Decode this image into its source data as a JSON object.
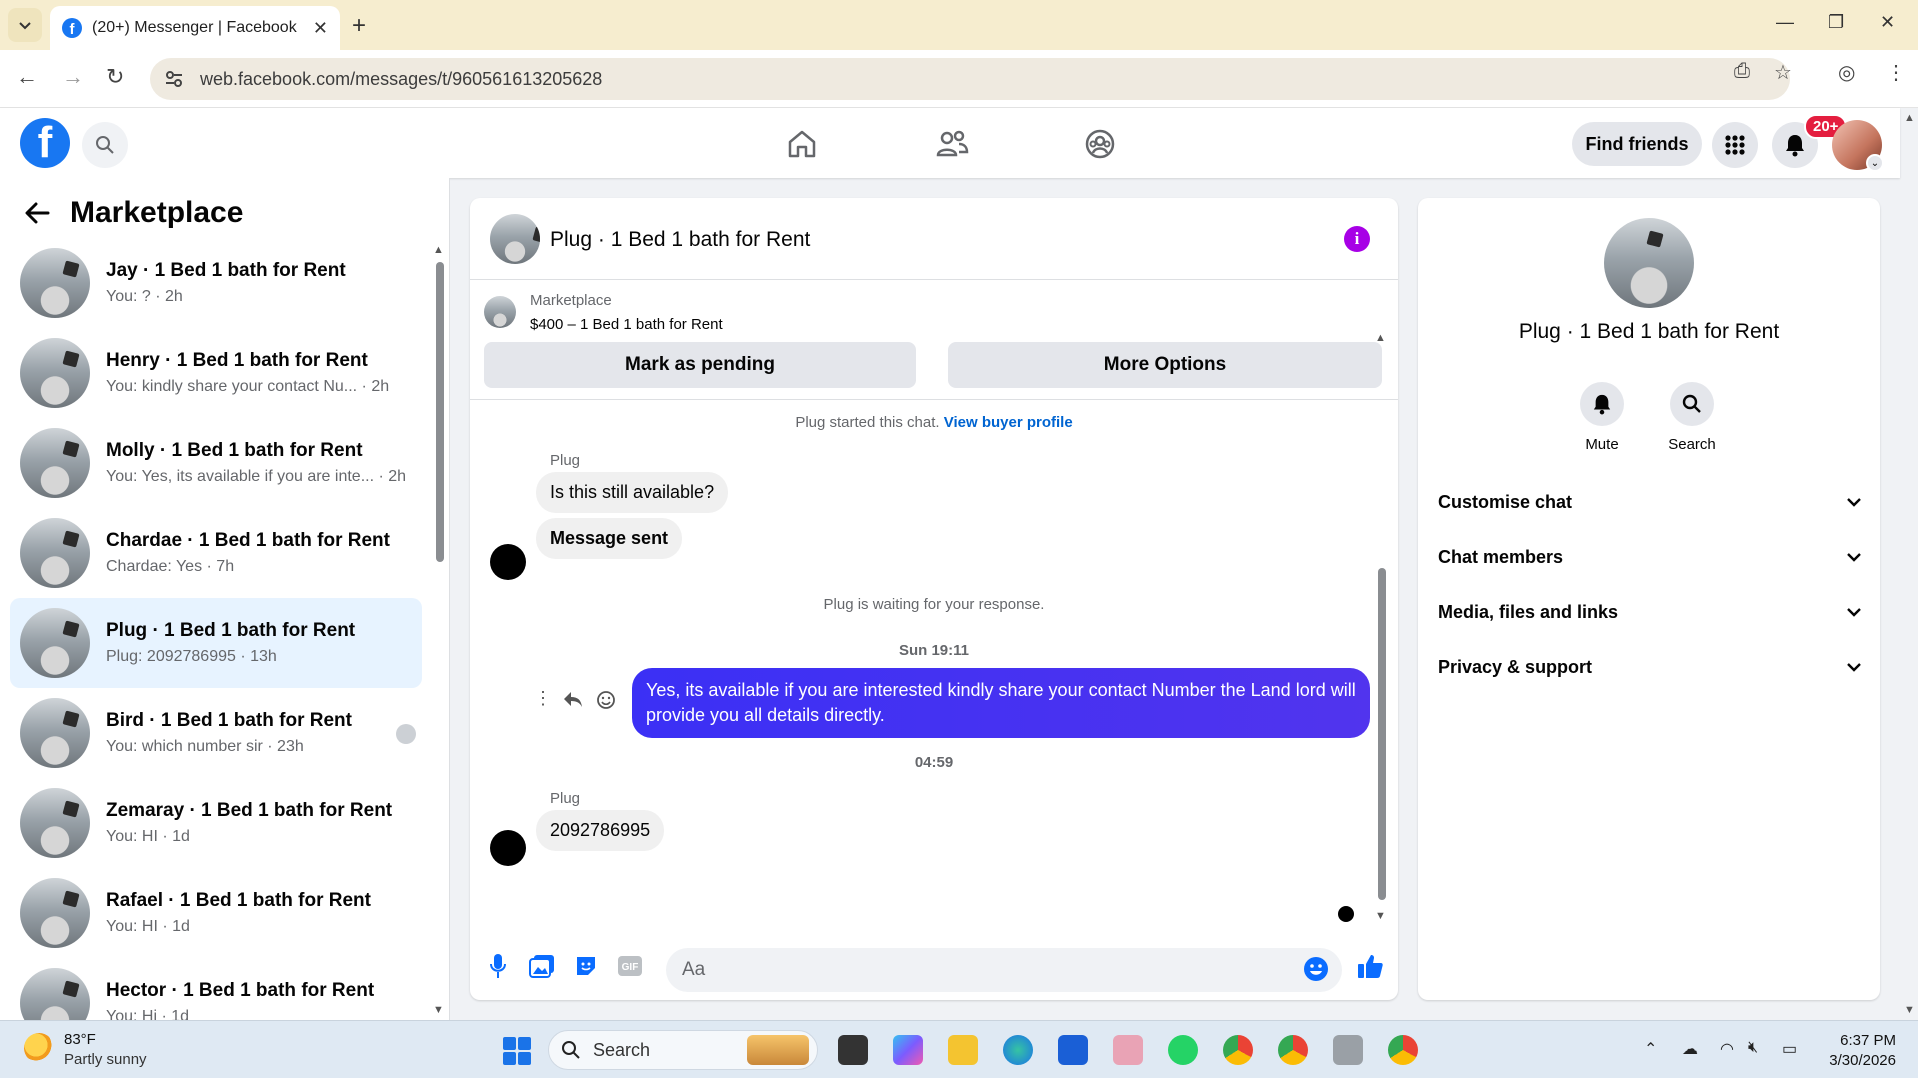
{
  "browser": {
    "tab_title": "(20+) Messenger | Facebook",
    "url": "web.facebook.com/messages/t/960561613205628"
  },
  "fb_header": {
    "find_friends": "Find friends",
    "notification_count": "20+"
  },
  "sidebar": {
    "title": "Marketplace",
    "conversations": [
      {
        "name": "Jay · 1 Bed 1 bath for Rent",
        "preview": "You: ? · 2h"
      },
      {
        "name": "Henry · 1 Bed 1 bath for Rent",
        "preview": "You: kindly share your contact Nu...   · 2h"
      },
      {
        "name": "Molly · 1 Bed 1 bath for Rent",
        "preview": "You: Yes, its available if you are inte... · 2h"
      },
      {
        "name": "Chardae · 1 Bed 1 bath for Rent",
        "preview": "Chardae: Yes · 7h"
      },
      {
        "name": "Plug · 1 Bed 1 bath for Rent",
        "preview": "Plug: 2092786995 · 13h"
      },
      {
        "name": "Bird · 1 Bed 1 bath for Rent",
        "preview": "You: which number sir · 23h"
      },
      {
        "name": "Zemaray · 1 Bed 1 bath for Rent",
        "preview": "You: HI · 1d"
      },
      {
        "name": "Rafael · 1 Bed 1 bath for Rent",
        "preview": "You: HI · 1d"
      },
      {
        "name": "Hector · 1 Bed 1 bath for Rent",
        "preview": "You: Hi · 1d"
      }
    ]
  },
  "chat": {
    "title": "Plug · 1 Bed 1 bath for Rent",
    "marketplace_label": "Marketplace",
    "listing": "$400 – 1 Bed 1 bath for Rent",
    "mark_pending": "Mark as pending",
    "more_options": "More Options",
    "started_text": "Plug started this chat.",
    "view_buyer": "View buyer profile",
    "sender_1": "Plug",
    "msg_1": "Is this still available?",
    "msg_2": "Message sent",
    "waiting": "Plug is waiting for your response.",
    "time_1": "Sun 19:11",
    "msg_out": "Yes, its available if you are interested kindly share your contact Number the Land lord will provide you all details directly.",
    "time_2": "04:59",
    "sender_2": "Plug",
    "msg_3": "2092786995",
    "composer_placeholder": "Aa"
  },
  "right_panel": {
    "title": "Plug · 1 Bed 1 bath for Rent",
    "mute": "Mute",
    "search": "Search",
    "rows": [
      "Customise chat",
      "Chat members",
      "Media, files and links",
      "Privacy & support"
    ]
  },
  "taskbar": {
    "temp": "83°F",
    "weather": "Partly sunny",
    "search": "Search",
    "time": "6:37 PM",
    "date": "3/30/2026"
  },
  "colors": {
    "fb_blue": "#1877f2",
    "outgoing_bubble": "#4f2cff",
    "active_conversation": "#e7f3ff",
    "info_purple": "#a700e6"
  }
}
